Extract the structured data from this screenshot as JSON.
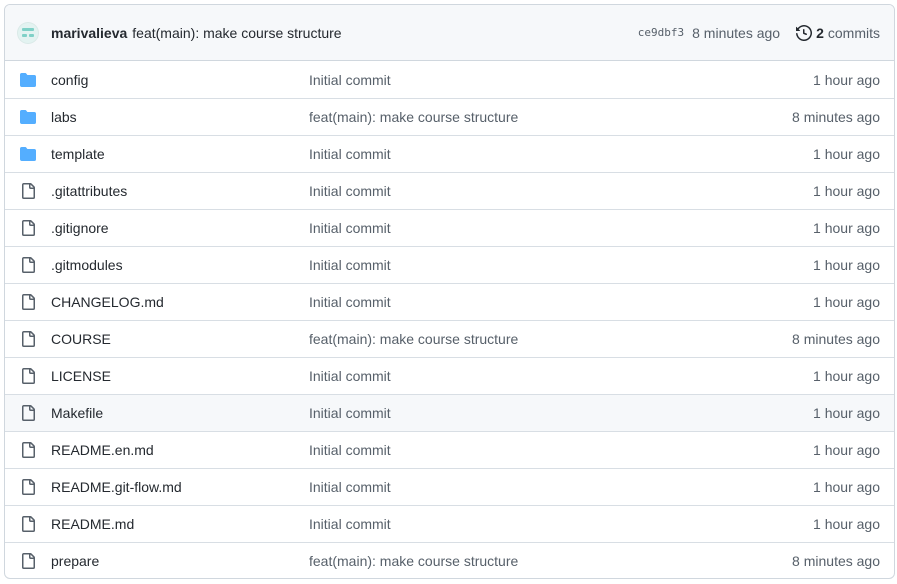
{
  "commit": {
    "author": "marivalieva",
    "message": "feat(main): make course structure",
    "sha": "ce9dbf3",
    "time": "8 minutes ago",
    "history_count": "2",
    "history_label": "commits"
  },
  "colors": {
    "folder": "#54aeff",
    "file": "#57606a",
    "border": "#d0d7de",
    "muted": "#57606a"
  },
  "files": [
    {
      "name": "config",
      "type": "folder",
      "message": "Initial commit",
      "time": "1 hour ago"
    },
    {
      "name": "labs",
      "type": "folder",
      "message": "feat(main): make course structure",
      "time": "8 minutes ago"
    },
    {
      "name": "template",
      "type": "folder",
      "message": "Initial commit",
      "time": "1 hour ago"
    },
    {
      "name": ".gitattributes",
      "type": "file",
      "message": "Initial commit",
      "time": "1 hour ago"
    },
    {
      "name": ".gitignore",
      "type": "file",
      "message": "Initial commit",
      "time": "1 hour ago"
    },
    {
      "name": ".gitmodules",
      "type": "file",
      "message": "Initial commit",
      "time": "1 hour ago"
    },
    {
      "name": "CHANGELOG.md",
      "type": "file",
      "message": "Initial commit",
      "time": "1 hour ago"
    },
    {
      "name": "COURSE",
      "type": "file",
      "message": "feat(main): make course structure",
      "time": "8 minutes ago"
    },
    {
      "name": "LICENSE",
      "type": "file",
      "message": "Initial commit",
      "time": "1 hour ago"
    },
    {
      "name": "Makefile",
      "type": "file",
      "message": "Initial commit",
      "time": "1 hour ago",
      "hovered": true
    },
    {
      "name": "README.en.md",
      "type": "file",
      "message": "Initial commit",
      "time": "1 hour ago"
    },
    {
      "name": "README.git-flow.md",
      "type": "file",
      "message": "Initial commit",
      "time": "1 hour ago"
    },
    {
      "name": "README.md",
      "type": "file",
      "message": "Initial commit",
      "time": "1 hour ago"
    },
    {
      "name": "prepare",
      "type": "file",
      "message": "feat(main): make course structure",
      "time": "8 minutes ago"
    }
  ]
}
